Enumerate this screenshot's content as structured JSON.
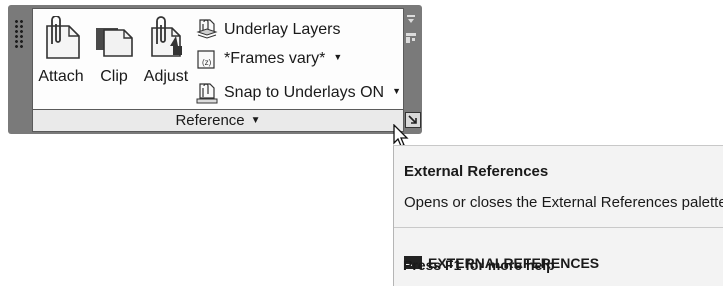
{
  "ribbon_panel": {
    "title": "Reference",
    "buttons": {
      "attach": "Attach",
      "clip": "Clip",
      "adjust": "Adjust"
    },
    "rows": {
      "underlay_layers": "Underlay Layers",
      "frames": "*Frames vary*",
      "snap": "Snap to Underlays ON"
    }
  },
  "tooltip": {
    "title": "External References",
    "description": "Opens or closes the External References palette",
    "command": "EXTERNALREFERENCES",
    "help": "Press F1 for more help"
  }
}
